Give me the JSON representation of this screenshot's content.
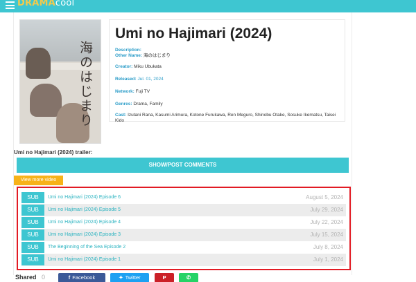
{
  "header": {
    "logo_part1": "DRAMA",
    "logo_part2": "cool",
    "menu_icon": "hamburger-menu-icon"
  },
  "drama": {
    "title": "Umi no Hajimari (2024)",
    "description_label": "Description:",
    "other_name_label": "Other Name:",
    "other_name": "海のはじまり",
    "creator_label": "Creator:",
    "creator": "Miku Ubukata",
    "released_label": "Released:",
    "released": "Jul. 01, 2024",
    "network_label": "Network:",
    "network": "Fuji TV",
    "genres_label": "Genres:",
    "genres": "Drama, Family",
    "cast_label": "Cast:",
    "cast": "Izutani Rana, Kasumi Arimura, Kotone Furukawa, Ren Meguro, Shinobu Otake, Sosuke Ikematsu, Taisei Kido",
    "poster_text": "海のはじまり"
  },
  "trailer_label": "Umi no Hajimari (2024) trailer:",
  "comments_button": "SHOW/POST COMMENTS",
  "view_more_button": "View more video",
  "episodes": [
    {
      "badge": "SUB",
      "name": "Umi no Hajimari (2024) Episode 6",
      "date": "August 5, 2024"
    },
    {
      "badge": "SUB",
      "name": "Umi no Hajimari (2024) Episode 5",
      "date": "July 29, 2024"
    },
    {
      "badge": "SUB",
      "name": "Umi no Hajimari (2024) Episode 4",
      "date": "July 22, 2024"
    },
    {
      "badge": "SUB",
      "name": "Umi no Hajimari (2024) Episode 3",
      "date": "July 15, 2024"
    },
    {
      "badge": "SUB",
      "name": "The Beginning of the Sea Episode 2",
      "date": "July 8, 2024"
    },
    {
      "badge": "SUB",
      "name": "Umi no Hajimari (2024) Episode 1",
      "date": "July 1, 2024"
    }
  ],
  "share": {
    "label": "Shared",
    "count": "0",
    "facebook": "Facebook",
    "twitter": "Twitter",
    "facebook_icon": "facebook-icon",
    "twitter_icon": "twitter-icon",
    "pinterest_icon": "pinterest-icon",
    "whatsapp_icon": "whatsapp-icon"
  },
  "colors": {
    "accent": "#3ec6d1",
    "highlight_border": "#e21b24",
    "view_more": "#f7b219",
    "link": "#2a9cc8"
  }
}
